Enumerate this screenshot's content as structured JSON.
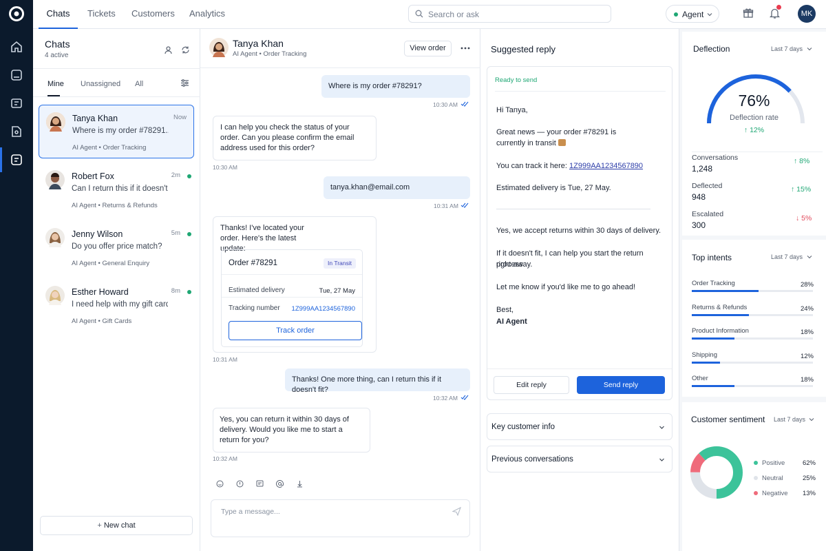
{
  "topnav": {
    "tabs": [
      "Chats",
      "Tickets",
      "Customers",
      "Analytics"
    ],
    "search_placeholder": "Search or ask",
    "agent_label": "Agent",
    "user_initials": "MK"
  },
  "chatlist": {
    "title": "Chats",
    "subtitle": "4 active",
    "filters": [
      "Mine",
      "Unassigned",
      "All"
    ],
    "items": [
      {
        "name": "Tanya Khan",
        "preview": "Where is my order #78291...",
        "agent": "AI Agent",
        "topic": "Order Tracking",
        "time": "Now"
      },
      {
        "name": "Robert Fox",
        "preview": "Can I return this if it doesn't...",
        "agent": "AI Agent",
        "topic": "Returns & Refunds",
        "time": "2m"
      },
      {
        "name": "Jenny Wilson",
        "preview": "Do you offer price match?",
        "agent": "AI Agent",
        "topic": "General Enquiry",
        "time": "5m"
      },
      {
        "name": "Esther Howard",
        "preview": "I need help with my gift card",
        "agent": "AI Agent",
        "topic": "Gift Cards",
        "time": "8m"
      }
    ],
    "new_chat": "New chat"
  },
  "conversation": {
    "name": "Tanya Khan",
    "agent": "AI Agent",
    "topic": "Order Tracking",
    "view_order": "View order",
    "messages": {
      "m1": "Where is my order #78291?",
      "m1_time": "10:30 AM",
      "m2": "I can help you check the status of your order. Can you please confirm the email address used for this order?",
      "m2_time": "10:30 AM",
      "m3": "tanya.khan@email.com",
      "m3_time": "10:31 AM",
      "m4": "Thanks! I've located your order. Here's the latest update:",
      "m4_time": "10:31 AM",
      "m5": "Thanks! One more thing, can I return this if it doesn't fit?",
      "m5_time": "10:32 AM",
      "m6": "Yes, you can return it within 30 days of delivery. Would you like me to start a return for you?",
      "m6_time": "10:32 AM"
    },
    "order_card": {
      "title": "Order #78291",
      "status": "In Transit",
      "delivery_label": "Estimated delivery",
      "delivery_value": "Tue, 27 May",
      "tracking_label": "Tracking number",
      "tracking_value": "1Z999AA1234567890",
      "track_button": "Track order"
    },
    "composer_placeholder": "Type a message..."
  },
  "suggested": {
    "title": "Suggested reply",
    "status": "Ready to send",
    "greeting": "Hi Tanya,",
    "line1a": "Great news — your order #78291 is",
    "line1b": "currently in transit",
    "line2": "You can track it here:",
    "tracking_link": "1Z999AA1234567890",
    "line3": "Estimated delivery is Tue, 27 May.",
    "line4": "Yes, we accept returns within 30 days of delivery.",
    "line5a": "If it doesn't fit, I can help you start the return process",
    "line5b": "right away.",
    "line6": "Let me know if you'd like me to go ahead!",
    "signoff": "Best,",
    "signature": "AI Agent",
    "edit_button": "Edit reply",
    "send_button": "Send reply",
    "key_info": "Key customer info",
    "previous": "Previous conversations"
  },
  "analytics": {
    "deflection": {
      "title": "Deflection",
      "range": "Last 7 days",
      "rate": "76%",
      "rate_value": 76,
      "rate_label": "Deflection rate",
      "change": "12%",
      "stats": [
        {
          "label": "Conversations",
          "value": "1,248",
          "change": "8%",
          "dir": "up"
        },
        {
          "label": "Deflected",
          "value": "948",
          "change": "15%",
          "dir": "up"
        },
        {
          "label": "Escalated",
          "value": "300",
          "change": "5%",
          "dir": "down"
        }
      ]
    },
    "intents": {
      "title": "Top intents",
      "range": "Last 7 days",
      "items": [
        {
          "name": "Order Tracking",
          "pct": "28%",
          "value": 28
        },
        {
          "name": "Returns & Refunds",
          "pct": "24%",
          "value": 24
        },
        {
          "name": "Product Information",
          "pct": "18%",
          "value": 18
        },
        {
          "name": "Shipping",
          "pct": "12%",
          "value": 12
        },
        {
          "name": "Other",
          "pct": "18%",
          "value": 18
        }
      ]
    },
    "sentiment": {
      "title": "Customer sentiment",
      "range": "Last 7 days",
      "items": [
        {
          "name": "Positive",
          "pct": "62%",
          "value": 62,
          "color": "#3cc39a"
        },
        {
          "name": "Neutral",
          "pct": "25%",
          "value": 25,
          "color": "#dfe3e9"
        },
        {
          "name": "Negative",
          "pct": "13%",
          "value": 13,
          "color": "#ef6b7b"
        }
      ]
    }
  }
}
